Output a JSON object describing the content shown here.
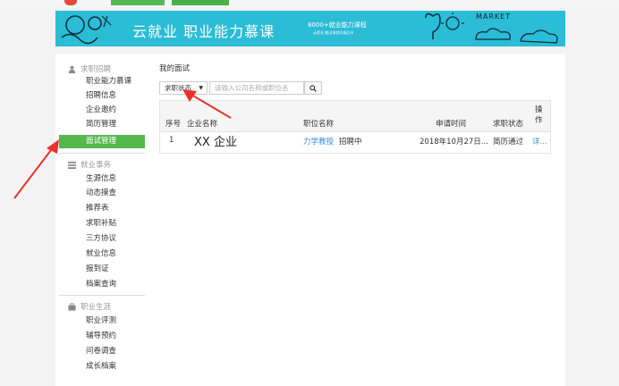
{
  "banner": {
    "title": "云就业  职业能力慕课",
    "subtitle1": "8000+就业能力课程",
    "subtitle2": "云就业 翻出课程的精品市",
    "market": "MARKET"
  },
  "sidebar": {
    "groups": [
      {
        "title": "求职招聘",
        "items": [
          "职业能力慕课",
          "招聘信息",
          "企业邀约",
          "简历管理",
          "面试管理"
        ]
      },
      {
        "title": "就业事务",
        "items": [
          "生源信息",
          "动态摸查",
          "推荐表",
          "求职补贴",
          "三方协议",
          "就业信息",
          "报到证",
          "档案查询"
        ]
      },
      {
        "title": "职业生涯",
        "items": [
          "职业评测",
          "辅导预约",
          "问卷调查",
          "成长档案"
        ]
      }
    ]
  },
  "content": {
    "title": "我的面试",
    "filter": {
      "selected": "求职状态"
    },
    "search": {
      "placeholder": "请输入公司名称或职位名"
    },
    "table": {
      "headers": [
        "序号",
        "企业名称",
        "职位名称",
        "申请时间",
        "求职状态",
        "操作"
      ],
      "rows": [
        {
          "index": "1",
          "company": "XX 企业",
          "position": "力学教授",
          "position_status": "招聘中",
          "applied": "2018年10月27日...",
          "status": "简历通过",
          "action": "详..."
        }
      ]
    }
  },
  "colors": {
    "accent_green": "#54b84f",
    "banner_blue": "#2bbcd6",
    "link_blue": "#3a8dd8",
    "arrow_red": "#e8322d"
  }
}
